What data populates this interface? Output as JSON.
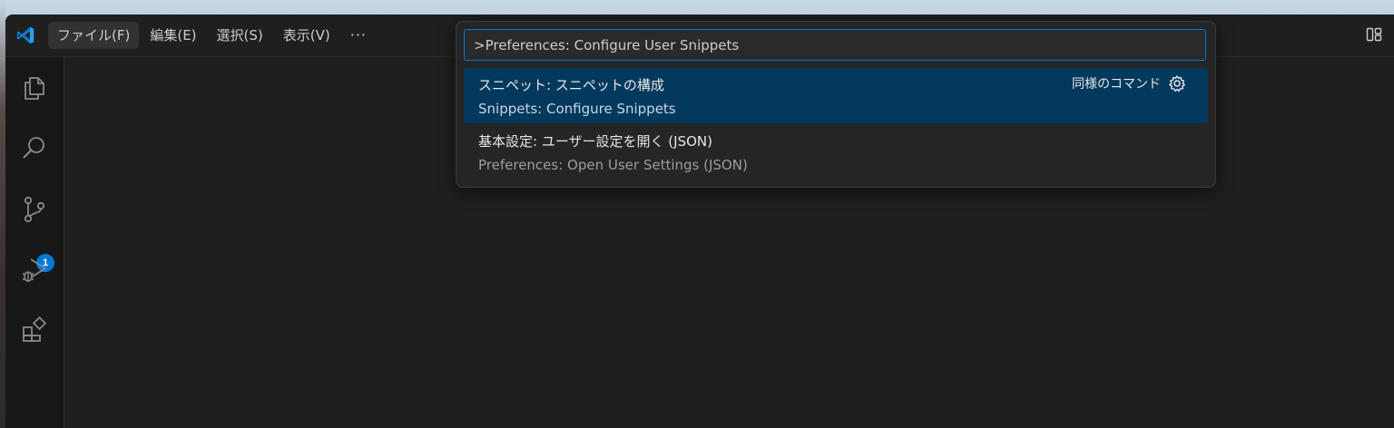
{
  "menubar": {
    "items": [
      "ファイル(F)",
      "編集(E)",
      "選択(S)",
      "表示(V)"
    ],
    "more": "···"
  },
  "activity": {
    "icons": [
      "explorer-icon",
      "search-icon",
      "source-control-icon",
      "run-debug-icon",
      "extensions-icon"
    ],
    "source_control_badge": "1"
  },
  "command_palette": {
    "input_value": ">Preferences: Configure User Snippets",
    "results": [
      {
        "label": "スニペット: スニペットの構成",
        "detail": "Snippets: Configure Snippets",
        "right_label": "同様のコマンド",
        "selected": true
      },
      {
        "label": "基本設定: ユーザー設定を開く (JSON)",
        "detail": "Preferences: Open User Settings (JSON)",
        "selected": false
      }
    ]
  },
  "colors": {
    "accent": "#0078d4",
    "selection": "#04395e",
    "editor_bg": "#1f1f1f"
  }
}
